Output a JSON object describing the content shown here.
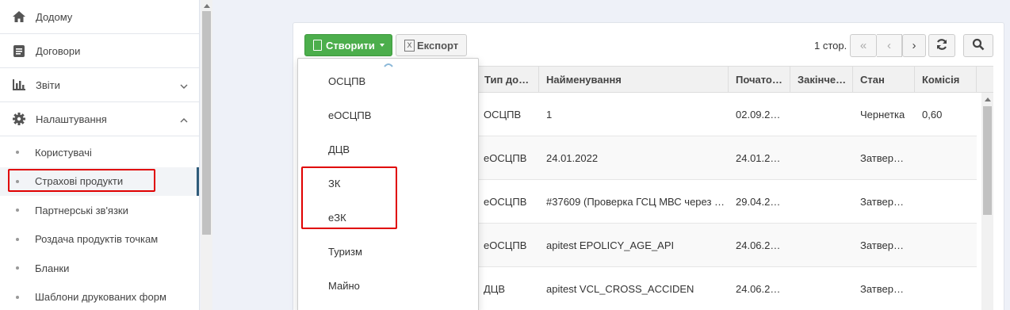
{
  "sidebar": {
    "main_items": [
      {
        "label": "Додому",
        "icon": "home-icon"
      },
      {
        "label": "Договори",
        "icon": "document-icon"
      },
      {
        "label": "Звіти",
        "icon": "bar-chart-icon"
      },
      {
        "label": "Налаштування",
        "icon": "gear-icon"
      }
    ],
    "sub_items": [
      {
        "label": "Користувачі"
      },
      {
        "label": "Страхові продукти",
        "active": true
      },
      {
        "label": "Партнерські зв'язки"
      },
      {
        "label": "Роздача продуктів точкам"
      },
      {
        "label": "Бланки"
      },
      {
        "label": "Шаблони друкованих форм"
      }
    ]
  },
  "toolbar": {
    "create_label": "Створити",
    "export_label": "Експорт",
    "export_icon_text": "X",
    "page_label": "1 стор."
  },
  "pagination": {
    "first": "«",
    "prev": "‹",
    "next": "›",
    "refresh_icon": "refresh-icon",
    "search_icon": "search-icon"
  },
  "dropdown": {
    "items": [
      "ОСЦПВ",
      "еОСЦПВ",
      "ДЦВ",
      "ЗК",
      "еЗК",
      "Туризм",
      "Майно"
    ]
  },
  "table": {
    "headers": [
      "Тип до…",
      "Найменування",
      "Почато…",
      "Закінче…",
      "Стан",
      "Комісія"
    ],
    "rows": [
      [
        "ОСЦПВ",
        "1",
        "02.09.2…",
        "",
        "Чернетка",
        "0,60"
      ],
      [
        "еОСЦПВ",
        "24.01.2022",
        "24.01.2…",
        "",
        "Затвер…",
        ""
      ],
      [
        "еОСЦПВ",
        "#37609 (Проверка ГСЦ МВС через …",
        "29.04.2…",
        "",
        "Затвер…",
        ""
      ],
      [
        "еОСЦПВ",
        "apitest EPOLICY_AGE_API",
        "24.06.2…",
        "",
        "Затвер…",
        ""
      ],
      [
        "ДЦВ",
        "apitest VCL_CROSS_ACCIDEN",
        "24.06.2…",
        "",
        "Затвер…",
        ""
      ]
    ]
  },
  "colors": {
    "create_button": "#4cae4c",
    "highlight_box": "#e00000",
    "active_marker": "#2f5b7a"
  }
}
